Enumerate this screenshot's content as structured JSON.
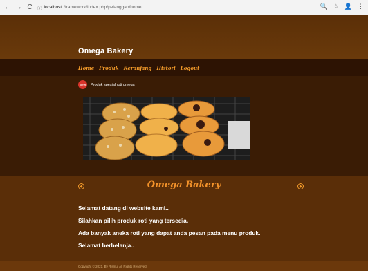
{
  "browser": {
    "url_prefix": "localhost",
    "url_path": "/framework/index.php/pelanggan/home",
    "back": "←",
    "forward": "→",
    "reload": "C",
    "info": "ⓘ",
    "zoom": "🔍",
    "star": "☆",
    "profile": "👤",
    "menu": "⋮"
  },
  "site": {
    "title": "Omega Bakery",
    "nav": [
      "Home",
      "Produk",
      "Keranjang",
      "Histori",
      "Logout"
    ],
    "badge_label": "NEW",
    "badge_text": "Produk spesial roti omega"
  },
  "welcome": {
    "title": "Omega Bakery",
    "lines": [
      "Selamat datang di website kami..",
      "Silahkan pilih produk roti yang tersedia.",
      "Ada banyak aneka roti yang dapat anda pesan pada menu produk.",
      "Selamat berbelanja.."
    ]
  },
  "footer": {
    "text": "Copyright © 2021, By Rismu, All Rights Reserved"
  },
  "colors": {
    "accent": "#f29a2a",
    "navbar": "#2d1303",
    "hero": "#5b2f07"
  }
}
